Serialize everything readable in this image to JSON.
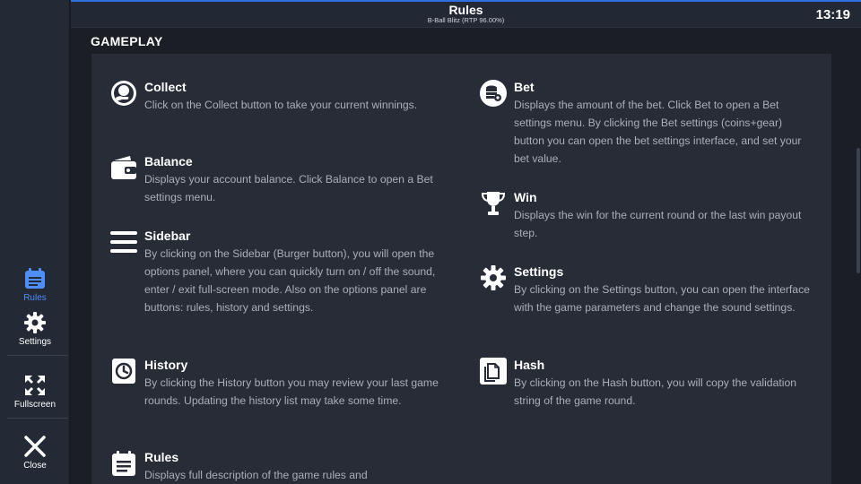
{
  "header": {
    "title": "Rules",
    "subtitle": "B-Ball Blitz (RTP 96.00%)",
    "clock": "13:19"
  },
  "sidebar": {
    "rules_label": "Rules",
    "settings_label": "Settings",
    "fullscreen_label": "Fullscreen",
    "close_label": "Close",
    "active_color": "#4f8ef7"
  },
  "section": {
    "title": "GAMEPLAY"
  },
  "items": {
    "collect": {
      "title": "Collect",
      "desc": "Click on the Collect button to take your current winnings.",
      "icon": "collect-icon"
    },
    "balance": {
      "title": "Balance",
      "desc": "Displays your account balance. Click Balance to open a Bet settings menu.",
      "icon": "wallet-icon"
    },
    "sidebar": {
      "title": "Sidebar",
      "desc": "By clicking on the Sidebar (Burger button), you will open the options panel, where you can quickly turn on / off the sound, enter / exit full-screen mode. Also on the options panel are buttons: rules, history and settings.",
      "icon": "burger-icon"
    },
    "history": {
      "title": "History",
      "desc": "By clicking the History button you may review your last game rounds. Updating the history list may take some time.",
      "icon": "history-icon"
    },
    "rules": {
      "title": "Rules",
      "desc": "Displays full description of the game rules and",
      "icon": "rules-icon"
    },
    "bet": {
      "title": "Bet",
      "desc": "Displays the amount of the bet. Click Bet to open a Bet settings menu. By clicking the Bet settings (coins+gear) button you can open the bet settings interface, and set your bet value.",
      "icon": "coins-icon"
    },
    "win": {
      "title": "Win",
      "desc": "Displays the win for the current round or the last win payout step.",
      "icon": "trophy-icon"
    },
    "settings": {
      "title": "Settings",
      "desc": "By clicking on the Settings button, you can open the interface with the game parameters and change the sound settings.",
      "icon": "gear-icon"
    },
    "hash": {
      "title": "Hash",
      "desc": "By clicking on the Hash button, you will copy the validation string of the game round.",
      "icon": "hash-icon"
    }
  }
}
